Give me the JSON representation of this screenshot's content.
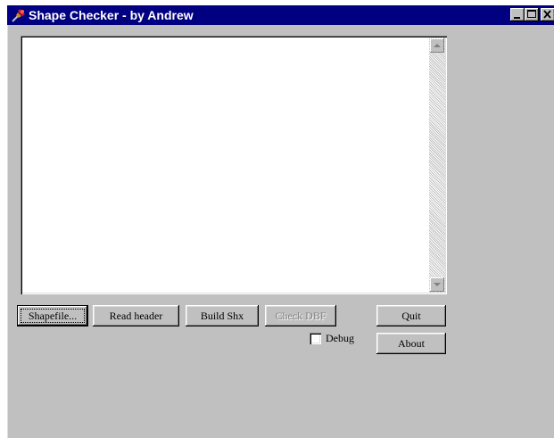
{
  "window": {
    "title": "Shape Checker - by Andrew",
    "title_bar_color": "#000080",
    "face_color": "#c0c0c0",
    "icon": "pin-icon"
  },
  "log": {
    "text": ""
  },
  "buttons": {
    "shapefile": "Shapefile...",
    "read_header": "Read header",
    "build_shx": "Build Shx",
    "check_dbf": "Check DBF",
    "quit": "Quit",
    "about": "About"
  },
  "debug": {
    "label": "Debug",
    "checked": false
  }
}
